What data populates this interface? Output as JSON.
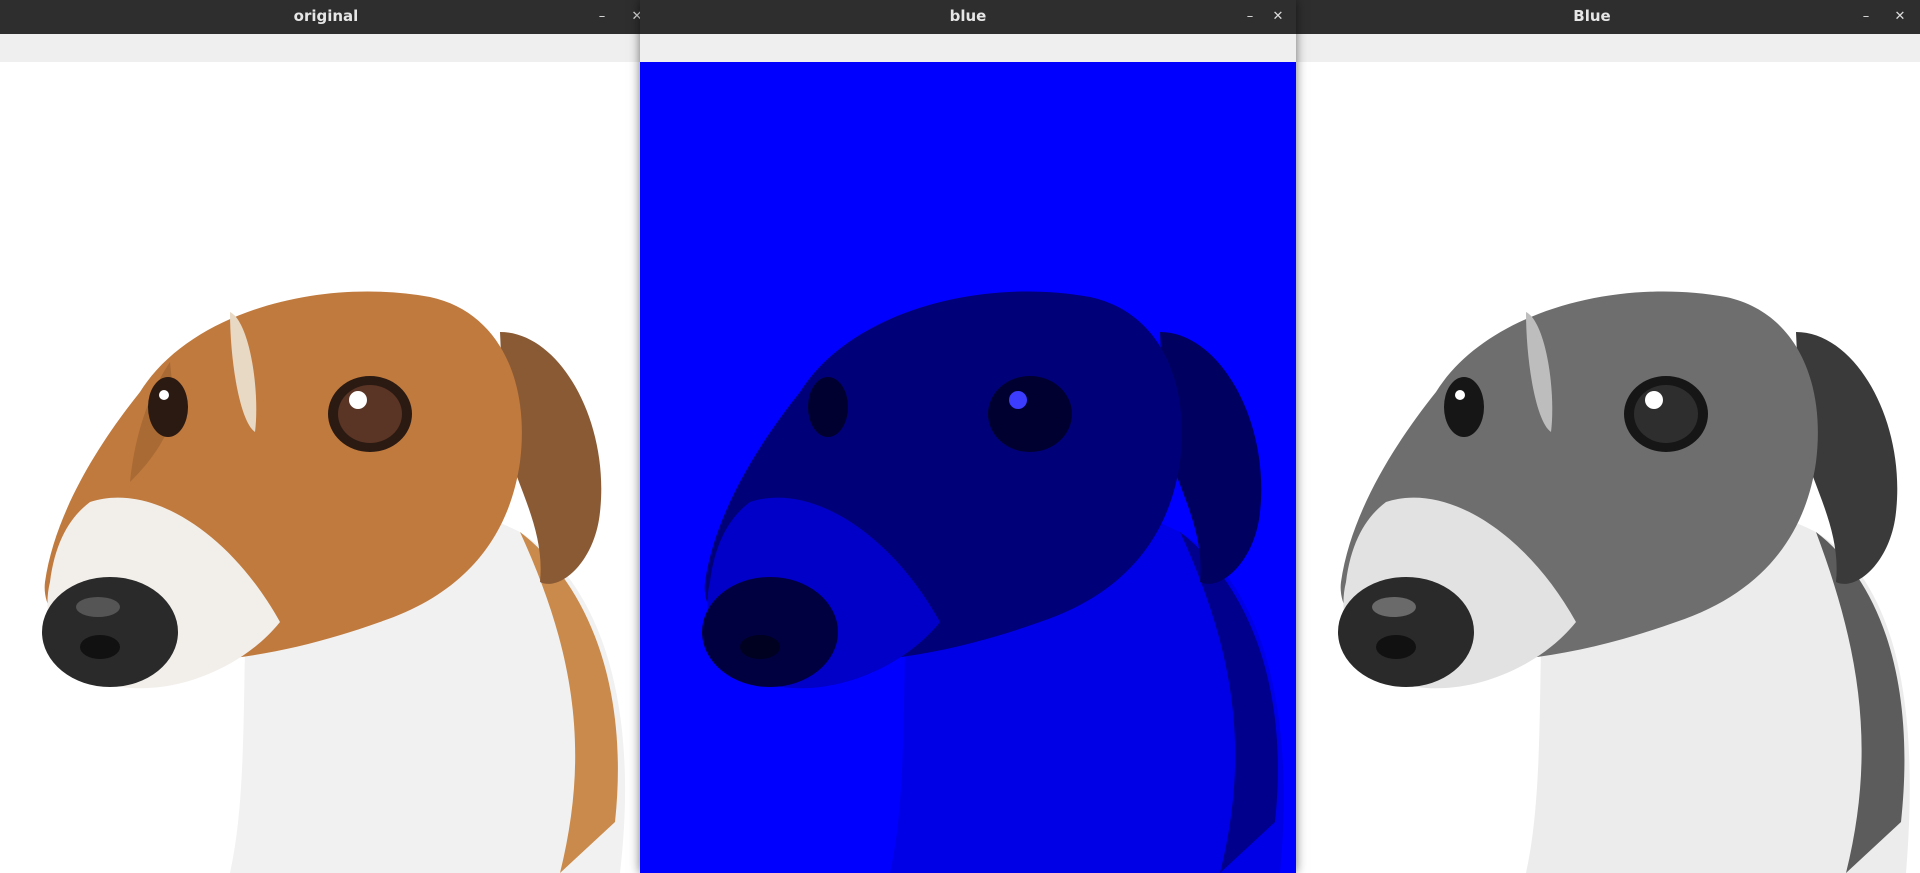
{
  "windows": [
    {
      "id": "original",
      "title": "original",
      "minimize_label": "–",
      "close_label": "✕",
      "image_variant": "color"
    },
    {
      "id": "blue-channel",
      "title": "blue",
      "minimize_label": "–",
      "close_label": "✕",
      "image_variant": "blue-tint"
    },
    {
      "id": "blue-grayscale",
      "title": "Blue",
      "minimize_label": "–",
      "close_label": "✕",
      "image_variant": "grayscale"
    }
  ],
  "colors": {
    "titlebar_bg": "#2e2e2e",
    "titlebar_text": "#e6e6e6",
    "toolbar_bg": "#efefef",
    "blue_canvas": "#0000ff"
  }
}
